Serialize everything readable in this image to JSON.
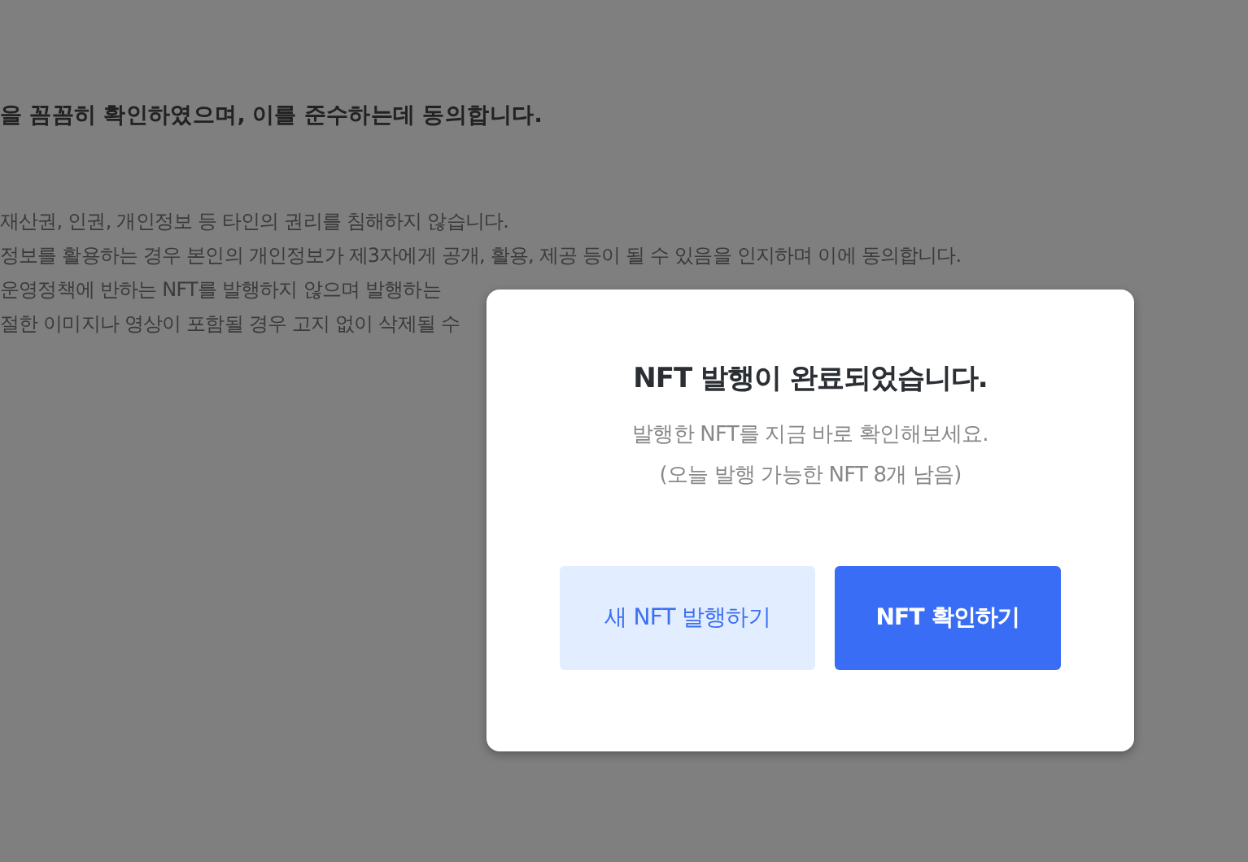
{
  "background": {
    "heading": "을 꼼꼼히 확인하였으며, 이를 준수하는데 동의합니다.",
    "lines": [
      "재산권, 인권, 개인정보 등 타인의 권리를 침해하지 않습니다.",
      "정보를 활용하는 경우 본인의 개인정보가 제3자에게 공개, 활용, 제공 등이 될 수 있음을 인지하며 이에 동의합니다.",
      "운영정책에 반하는 NFT를 발행하지 않으며 발행하는",
      "절한 이미지나 영상이 포함될 경우 고지 없이 삭제될 수"
    ]
  },
  "dialog": {
    "title": "NFT 발행이 완료되었습니다.",
    "message": [
      "발행한 NFT를 지금 바로 확인해보세요.",
      "(오늘 발행 가능한 NFT 8개 남음)"
    ],
    "buttons": [
      {
        "label": "새 NFT 발행하기",
        "kind": "secondary"
      },
      {
        "label": "NFT 확인하기",
        "kind": "primary"
      }
    ]
  }
}
